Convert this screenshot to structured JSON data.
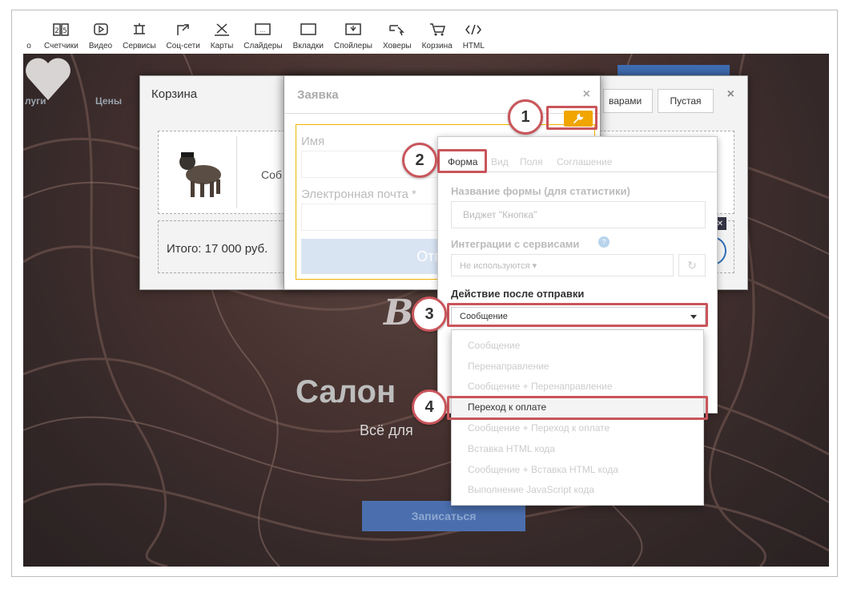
{
  "toolbar": {
    "items": [
      {
        "label": "о",
        "icon": "partial-icon"
      },
      {
        "label": "Счетчики",
        "icon": "counter-icon"
      },
      {
        "label": "Видео",
        "icon": "video-icon"
      },
      {
        "label": "Сервисы",
        "icon": "services-icon"
      },
      {
        "label": "Соц-сети",
        "icon": "social-icon"
      },
      {
        "label": "Карты",
        "icon": "map-icon"
      },
      {
        "label": "Слайдеры",
        "icon": "slider-icon"
      },
      {
        "label": "Вкладки",
        "icon": "tabs-icon"
      },
      {
        "label": "Спойлеры",
        "icon": "spoiler-icon"
      },
      {
        "label": "Ховеры",
        "icon": "hover-icon"
      },
      {
        "label": "Корзина",
        "icon": "cart-icon"
      },
      {
        "label": "HTML",
        "icon": "code-icon"
      }
    ]
  },
  "page": {
    "nav_services": "луги",
    "nav_prices": "Цены",
    "hero_title": "Салон",
    "hero_b": "B",
    "hero_sub": "Всё для",
    "cta": "Записаться"
  },
  "cart": {
    "title": "Корзина",
    "tab_with_items": "варами",
    "tab_empty": "Пустая",
    "item_name": "Соб",
    "total": "Итого: 17 000 руб.",
    "close": "×"
  },
  "request": {
    "title": "Заявка",
    "close": "×",
    "name_label": "Имя",
    "email_label": "Электронная почта *",
    "submit": "Отправи"
  },
  "panel": {
    "tabs": [
      "Форма",
      "Вид",
      "Поля",
      "Соглашение"
    ],
    "form_name_label": "Название формы (для статистики)",
    "form_name_placeholder": "Виджет \"Кнопка\"",
    "integrations_label": "Интеграции с сервисами",
    "integrations_value": "Не используются ▾",
    "action_label": "Действие после отправки",
    "action_value": "Сообщение"
  },
  "dropdown": {
    "options": [
      "Сообщение",
      "Перенаправление",
      "Сообщение + Перенаправление",
      "Переход к оплате",
      "Сообщение + Переход к оплате",
      "Вставка HTML кода",
      "Сообщение + Вставка HTML кода",
      "Выполнение JavaScript кода"
    ],
    "highlighted_index": 3
  },
  "callouts": {
    "step1": "1",
    "step2": "2",
    "step3": "3",
    "step4": "4"
  },
  "colors": {
    "callout": "#c9555b",
    "wrench": "#f0a500",
    "accent": "#3f6db3"
  }
}
